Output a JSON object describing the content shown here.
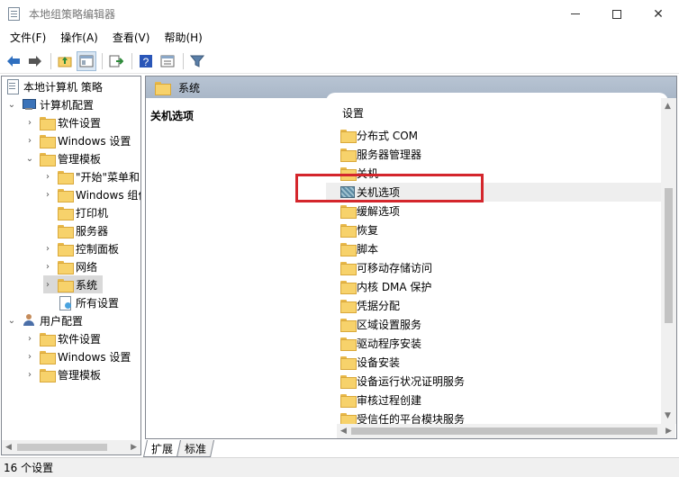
{
  "window": {
    "title": "本地组策略编辑器",
    "minimize": "—",
    "maximize": "☐",
    "close": "✕"
  },
  "menu": [
    "文件(F)",
    "操作(A)",
    "查看(V)",
    "帮助(H)"
  ],
  "toolbar": {
    "icons": [
      "back-arrow-icon",
      "forward-arrow-icon",
      "up-folder-icon",
      "show-hide-tree-icon",
      "export-list-icon",
      "help-icon",
      "properties-icon",
      "filter-icon"
    ],
    "colors": {
      "back": "#2f6fbf",
      "forward": "#555555",
      "help": "#2a56b8",
      "filter": "#5a7fa8"
    }
  },
  "tree": {
    "root": "本地计算机 策略",
    "computer_config": "计算机配置",
    "cc_software": "软件设置",
    "cc_windows": "Windows 设置",
    "cc_admin": "管理模板",
    "at_start": "\"开始\"菜单和",
    "at_windows": "Windows 组件",
    "at_printers": "打印机",
    "at_servers": "服务器",
    "at_control_panel": "控制面板",
    "at_network": "网络",
    "at_system": "系统",
    "at_all": "所有设置",
    "user_config": "用户配置",
    "uc_software": "软件设置",
    "uc_windows": "Windows 设置",
    "uc_admin": "管理模板"
  },
  "header": {
    "title": "系统"
  },
  "description": {
    "title": "关机选项"
  },
  "list": {
    "column": "设置",
    "items": [
      "分布式 COM",
      "服务器管理器",
      "关机",
      "关机选项",
      "缓解选项",
      "恢复",
      "脚本",
      "可移动存储访问",
      "内核 DMA 保护",
      "凭据分配",
      "区域设置服务",
      "驱动程序安装",
      "设备安装",
      "设备运行状况证明服务",
      "审核过程创建",
      "受信任的平台模块服务"
    ],
    "selected": "关机选项"
  },
  "tabs": [
    "扩展",
    "标准"
  ],
  "status": {
    "text": "16 个设置"
  },
  "highlight_color": "#d4262c"
}
